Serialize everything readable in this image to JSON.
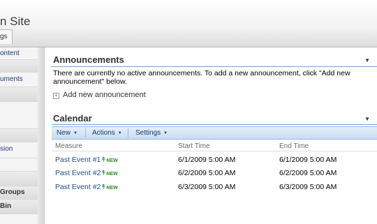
{
  "header": {
    "site_title": "n Site",
    "tab_label": "gs"
  },
  "leftnav": {
    "items": [
      {
        "label": "ontent",
        "head": false
      },
      {
        "label": "",
        "head": true
      },
      {
        "label": "uments",
        "head": false
      },
      {
        "label": "",
        "head": true
      },
      {
        "label": "",
        "head": false
      },
      {
        "label": "",
        "head": true
      },
      {
        "label": "sion",
        "head": false
      },
      {
        "label": "",
        "head": false
      },
      {
        "label": "",
        "head": true
      },
      {
        "label": "Groups",
        "head": true
      },
      {
        "label": "Bin",
        "head": true
      }
    ]
  },
  "announcements": {
    "title": "Announcements",
    "message": "There are currently no active announcements. To add a new announcement, click \"Add new announcement\" below.",
    "add_link": "Add new announcement"
  },
  "calendar": {
    "title": "Calendar",
    "toolbar": {
      "new": "New",
      "actions": "Actions",
      "settings": "Settings"
    },
    "columns": [
      "Measure",
      "Start Time",
      "End Time"
    ],
    "rows": [
      {
        "measure": "Past Event #1",
        "start": "6/1/2009 5:00 AM",
        "end": "6/1/2009 5:00 AM",
        "badge": "NEW"
      },
      {
        "measure": "Past Event #2",
        "start": "6/2/2009 5:00 AM",
        "end": "6/2/2009 5:00 AM",
        "badge": "NEW"
      },
      {
        "measure": "Past Event #2",
        "start": "6/3/2009 5:00 AM",
        "end": "6/3/2009 5:00 AM",
        "badge": "NEW"
      }
    ]
  },
  "colors": {
    "accent_line": "#7aa1d6",
    "link": "#1f4c8f",
    "new_badge": "#2a8a2a",
    "toolbar": "#c7dcf3"
  }
}
